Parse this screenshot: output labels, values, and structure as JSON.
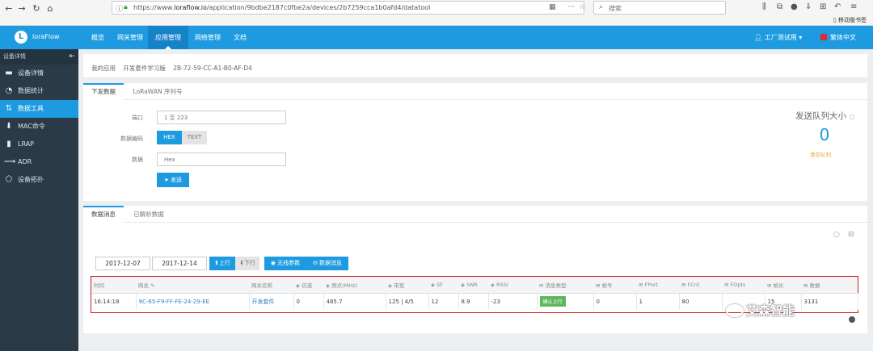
{
  "browser": {
    "url_prefix": "https://www.",
    "url_domain": "loraflow.io",
    "url_path": "/application/9bdbe2187c0fbe2a/devices/2b7259cca1b0afd4/datatool",
    "search_placeholder": "搜索",
    "bookmark_label": "移动版书签"
  },
  "app": {
    "brand": "loraFlow",
    "logo_glyph": "L",
    "menu": [
      "概览",
      "网关管理",
      "应用管理",
      "网络管理",
      "文档"
    ],
    "active_menu": 2,
    "user_label": "工厂测试用",
    "lang_label": "繁体中文",
    "colors": {
      "primary": "#1e9be0",
      "sidebar": "#2a3a47",
      "highlight_border": "#c42020",
      "queue_clear": "#e8a128"
    }
  },
  "sidebar": {
    "header": "设备详情",
    "items": [
      {
        "label": "设备详情",
        "icon": "monitor-icon"
      },
      {
        "label": "数据统计",
        "icon": "clock-icon"
      },
      {
        "label": "数据工具",
        "icon": "transfer-icon"
      },
      {
        "label": "MAC命令",
        "icon": "download-arrow-icon"
      },
      {
        "label": "LRAP",
        "icon": "device-icon"
      },
      {
        "label": "ADR",
        "icon": "signal-icon"
      },
      {
        "label": "设备拓扑",
        "icon": "pentagon-icon"
      }
    ],
    "active_index": 2
  },
  "breadcrumb": {
    "items": [
      "我的应用",
      "开发套件学习版",
      "2B-72-59-CC-A1-B0-AF-D4"
    ]
  },
  "downlink": {
    "tabs": [
      "下发数据",
      "LoRaWAN 序列号"
    ],
    "port_label": "端口",
    "port_placeholder": "1 至 223",
    "format_label": "数据编码",
    "format_hex": "HEX",
    "format_text": "TEXT",
    "data_label": "数据",
    "data_placeholder": "Hex",
    "send_label": "发送",
    "queue_title": "发送队列大小",
    "queue_value": "0",
    "queue_clear": "清空队列"
  },
  "messages": {
    "tabs": [
      "数据消息",
      "已解析数据"
    ],
    "date_from": "2017-12-07",
    "date_to": "2017-12-14",
    "btn_up": "上行",
    "btn_down": "下行",
    "btn_params": "无线参数",
    "btn_msg": "数据消息",
    "columns": [
      "时间",
      "网关",
      "网关名称",
      "信道",
      "频点(MHz)",
      "带宽",
      "SF",
      "SNR",
      "RSSI",
      "消息类型",
      "帧号",
      "FPort",
      "FCnt",
      "FOpts",
      "帧长",
      "数据"
    ],
    "rows": [
      [
        "16:14:18",
        "9C-65-F9-FF-FE-24-29-EE",
        "开发套件",
        "0",
        "485.7",
        "125 | 4/5",
        "12",
        "8.9",
        "-23",
        "确认上行",
        "0",
        "1",
        "80",
        "",
        "15",
        "3131"
      ]
    ]
  },
  "watermark": {
    "text": "艾森智能"
  }
}
